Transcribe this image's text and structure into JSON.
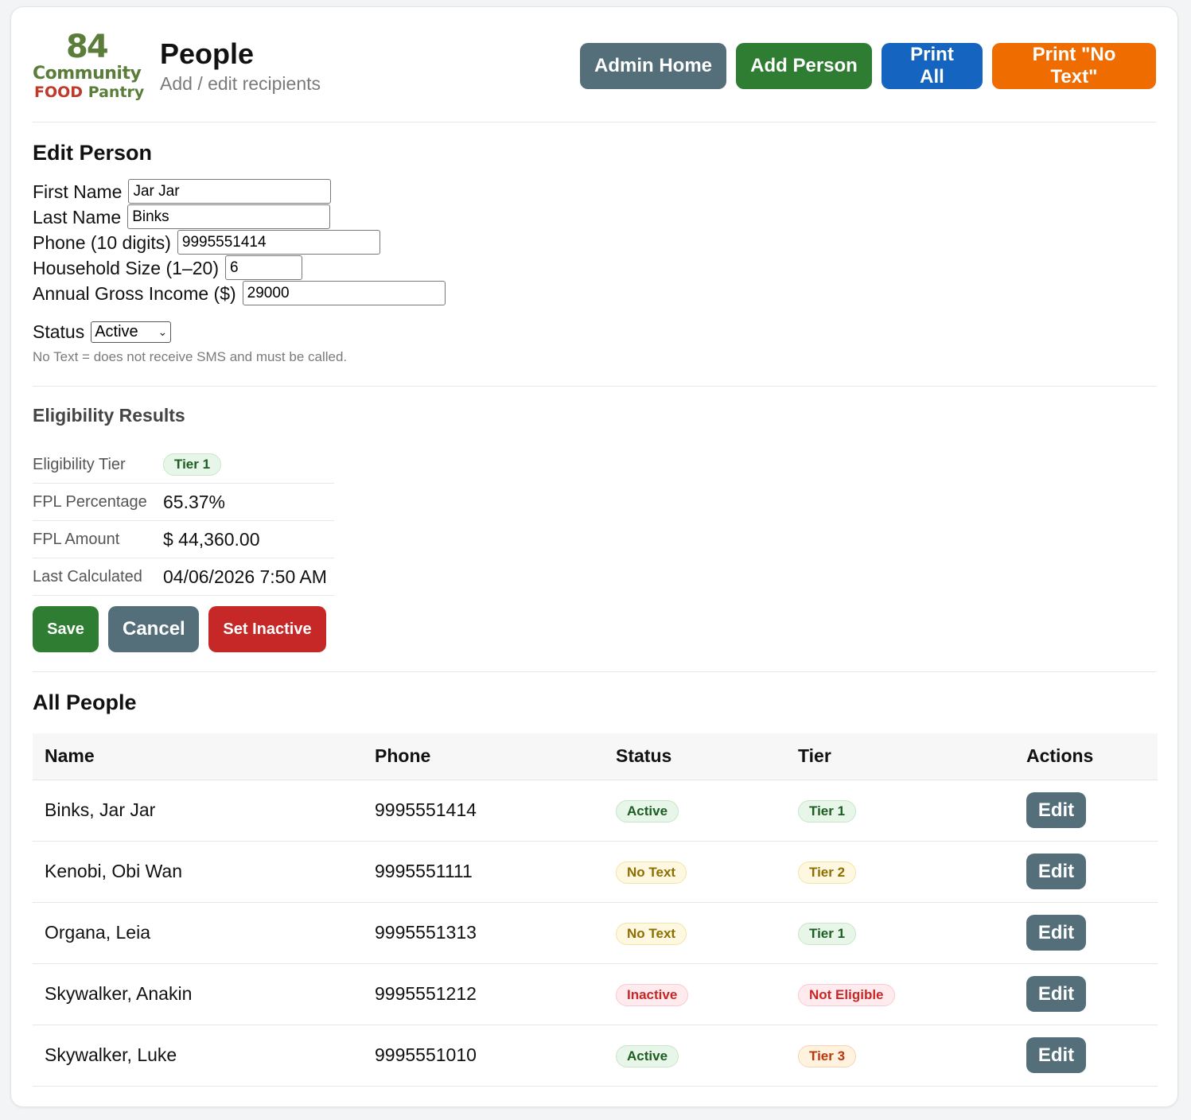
{
  "colors": {
    "slate": "#546e7a",
    "green": "#2e7d32",
    "blue": "#1565c0",
    "orange": "#ef6c00",
    "red": "#c62828"
  },
  "logo": {
    "number": "84",
    "line1": "Community",
    "line2a": "FOOD",
    "line2b": "Pantry"
  },
  "header": {
    "title": "People",
    "subtitle": "Add / edit recipients",
    "buttons": {
      "admin_home": "Admin Home",
      "add_person": "Add Person",
      "print_all": "Print All",
      "print_no_text": "Print \"No Text\""
    }
  },
  "edit": {
    "title": "Edit Person",
    "fields": {
      "first_name": {
        "label": "First Name",
        "value": "Jar Jar"
      },
      "last_name": {
        "label": "Last Name",
        "value": "Binks"
      },
      "phone": {
        "label": "Phone (10 digits)",
        "value": "9995551414"
      },
      "household": {
        "label": "Household Size (1–20)",
        "value": "6"
      },
      "income": {
        "label": "Annual Gross Income ($)",
        "value": "29000"
      }
    },
    "status": {
      "label": "Status",
      "selected": "Active"
    },
    "hint": "No Text = does not receive SMS and must be called."
  },
  "eligibility": {
    "title": "Eligibility Results",
    "tier": {
      "label": "Eligibility Tier",
      "value": "Tier 1"
    },
    "fpl_percentage": {
      "label": "FPL Percentage",
      "value": "65.37%"
    },
    "fpl_amount": {
      "label": "FPL Amount",
      "value": "$ 44,360.00"
    },
    "last_calculated": {
      "label": "Last Calculated",
      "value": "04/06/2026 7:50 AM"
    }
  },
  "form_buttons": {
    "save": "Save",
    "cancel": "Cancel",
    "set_inactive": "Set Inactive"
  },
  "people": {
    "title": "All People",
    "columns": {
      "name": "Name",
      "phone": "Phone",
      "status": "Status",
      "tier": "Tier",
      "actions": "Actions"
    },
    "edit_label": "Edit",
    "rows": [
      {
        "name": "Binks, Jar Jar",
        "phone": "9995551414",
        "status": "Active",
        "tier": "Tier 1"
      },
      {
        "name": "Kenobi, Obi Wan",
        "phone": "9995551111",
        "status": "No Text",
        "tier": "Tier 2"
      },
      {
        "name": "Organa, Leia",
        "phone": "9995551313",
        "status": "No Text",
        "tier": "Tier 1"
      },
      {
        "name": "Skywalker, Anakin",
        "phone": "9995551212",
        "status": "Inactive",
        "tier": "Not Eligible"
      },
      {
        "name": "Skywalker, Luke",
        "phone": "9995551010",
        "status": "Active",
        "tier": "Tier 3"
      }
    ]
  }
}
